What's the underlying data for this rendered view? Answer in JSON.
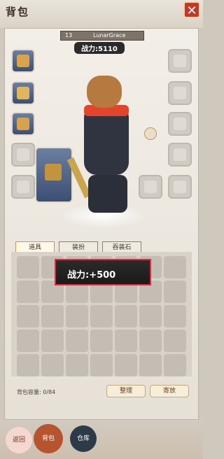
{
  "header": {
    "title": "背包",
    "close_icon": "close-icon"
  },
  "character": {
    "level": "13",
    "name": "LunarGrace",
    "power_label": "战力:",
    "power_value": "5110"
  },
  "equipment_left": [
    {
      "name": "amulet",
      "icon": "amulet-icon"
    },
    {
      "name": "armor",
      "icon": "armor-icon"
    },
    {
      "name": "boots",
      "icon": "boots-icon"
    },
    {
      "name": "empty-slot",
      "icon": "empty-slot-icon"
    },
    {
      "name": "empty-slot",
      "icon": "empty-slot-icon"
    }
  ],
  "equipment_right": [
    {
      "name": "empty-slot",
      "icon": "empty-slot-icon"
    },
    {
      "name": "empty-slot",
      "icon": "empty-slot-icon"
    },
    {
      "name": "empty-slot",
      "icon": "empty-slot-icon"
    },
    {
      "name": "empty-slot",
      "icon": "empty-slot-icon"
    },
    {
      "name": "empty-slot",
      "icon": "empty-slot-icon"
    }
  ],
  "weapon_slot": {
    "icon": "weapon-icon"
  },
  "tabs": [
    {
      "label": "道具"
    },
    {
      "label": "装扮"
    },
    {
      "label": "吞装石"
    }
  ],
  "highlight_text": "战力:+500",
  "grid": {
    "rows": 5,
    "cols": 7
  },
  "footer": {
    "capacity_label": "背包容量: 0/84",
    "sort_button": "整理",
    "storage_button": "寄放"
  },
  "bottom_nav": {
    "return": "返回",
    "bag": "背包",
    "warehouse": "仓库"
  },
  "colors": {
    "highlight": "#e5283a",
    "accent": "#c0392b"
  }
}
